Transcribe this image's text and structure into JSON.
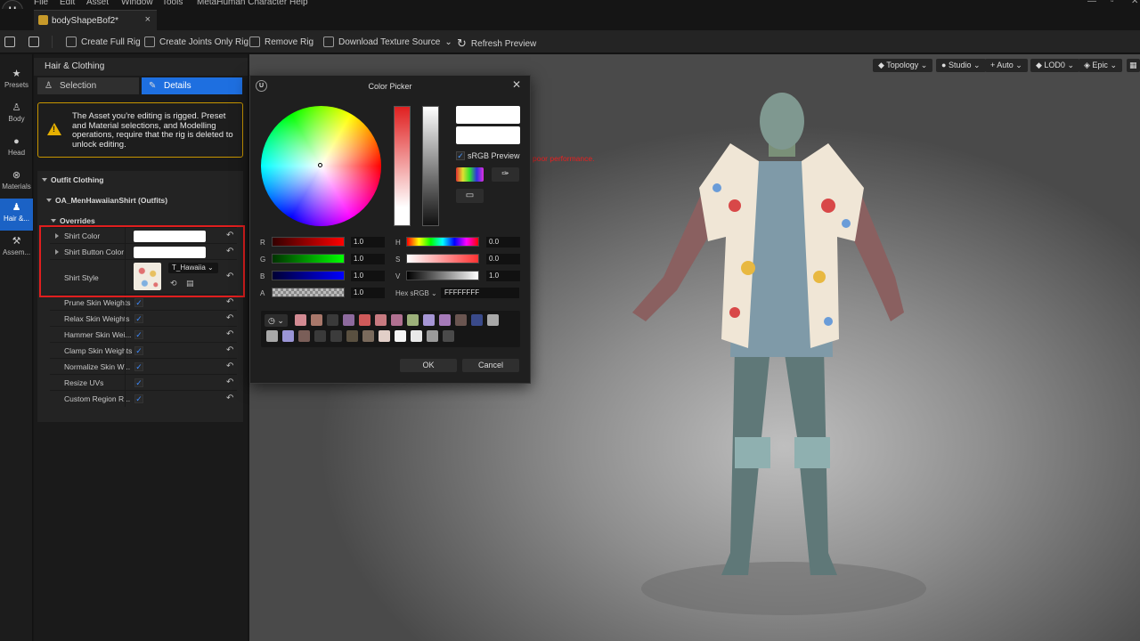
{
  "menu": [
    "File",
    "Edit",
    "Asset",
    "Window",
    "Tools",
    "MetaHuman Character",
    "Help"
  ],
  "tab": {
    "title": "bodyShapeBof2*"
  },
  "toolbar": {
    "create_full_rig": "Create Full Rig",
    "create_joints_rig": "Create Joints Only Rig",
    "remove_rig": "Remove Rig",
    "download_texture": "Download Texture Source",
    "refresh_preview": "Refresh Preview"
  },
  "sidebar": {
    "items": [
      {
        "label": "Presets",
        "icon": "star-icon"
      },
      {
        "label": "Body",
        "icon": "body-icon"
      },
      {
        "label": "Head",
        "icon": "head-icon"
      },
      {
        "label": "Materials",
        "icon": "materials-icon"
      },
      {
        "label": "Hair &...",
        "icon": "hair-icon"
      },
      {
        "label": "Assem...",
        "icon": "hammer-icon"
      }
    ],
    "active_index": 4
  },
  "panel": {
    "title": "Hair & Clothing",
    "tab_selection": "Selection",
    "tab_details": "Details",
    "warning": "The Asset you're editing is rigged. Preset and Material selections, and Modelling operations, require that the rig is deleted to unlock editing.",
    "outfit_section": "Outfit Clothing",
    "outfit_item": "OA_MenHawaiianShirt (Outfits)",
    "overrides": "Overrides",
    "shirt_color": "Shirt Color",
    "shirt_button_color": "Shirt Button Color",
    "shirt_style": "Shirt Style",
    "texture_name": "T_Hawaiia",
    "checkbox_rows": [
      "Prune Skin Weights",
      "Relax Skin Weights",
      "Hammer Skin Wei...",
      "Clamp Skin Weights",
      "Normalize Skin W...",
      "Resize UVs",
      "Custom Region R..."
    ]
  },
  "viewport": {
    "topology": "Topology",
    "studio": "Studio",
    "auto": "Auto",
    "lod": "LOD0",
    "epic": "Epic",
    "perf_warning": "poor performance."
  },
  "color_picker": {
    "title": "Color Picker",
    "srgb_preview": "sRGB Preview",
    "r_label": "R",
    "r_value": "1.0",
    "g_label": "G",
    "g_value": "1.0",
    "b_label": "B",
    "b_value": "1.0",
    "a_label": "A",
    "a_value": "1.0",
    "h_label": "H",
    "h_value": "0.0",
    "s_label": "S",
    "s_value": "0.0",
    "v_label": "V",
    "v_value": "1.0",
    "hex_label": "Hex sRGB",
    "hex_value": "FFFFFFFF",
    "ok": "OK",
    "cancel": "Cancel",
    "swatches_row1": [
      "#d28a92",
      "#a8776a",
      "#3a3a3a",
      "#8d6a9e",
      "#cf5a5a",
      "#c77a80",
      "#b07090",
      "#9cb07a",
      "#a595d4",
      "#a57ab8",
      "#6a5550",
      "#3a4a8a",
      "#a8a8a8"
    ],
    "swatches_row2": [
      "#a8a8a8",
      "#9b95d6",
      "#7a5e58",
      "#3a3a3a",
      "#3c3c3c",
      "#5a5040",
      "#7a6a5c",
      "#e2cfc8",
      "#f4f4f4",
      "#e9e9e9",
      "#9a9a9a",
      "#4a4a4a"
    ]
  }
}
